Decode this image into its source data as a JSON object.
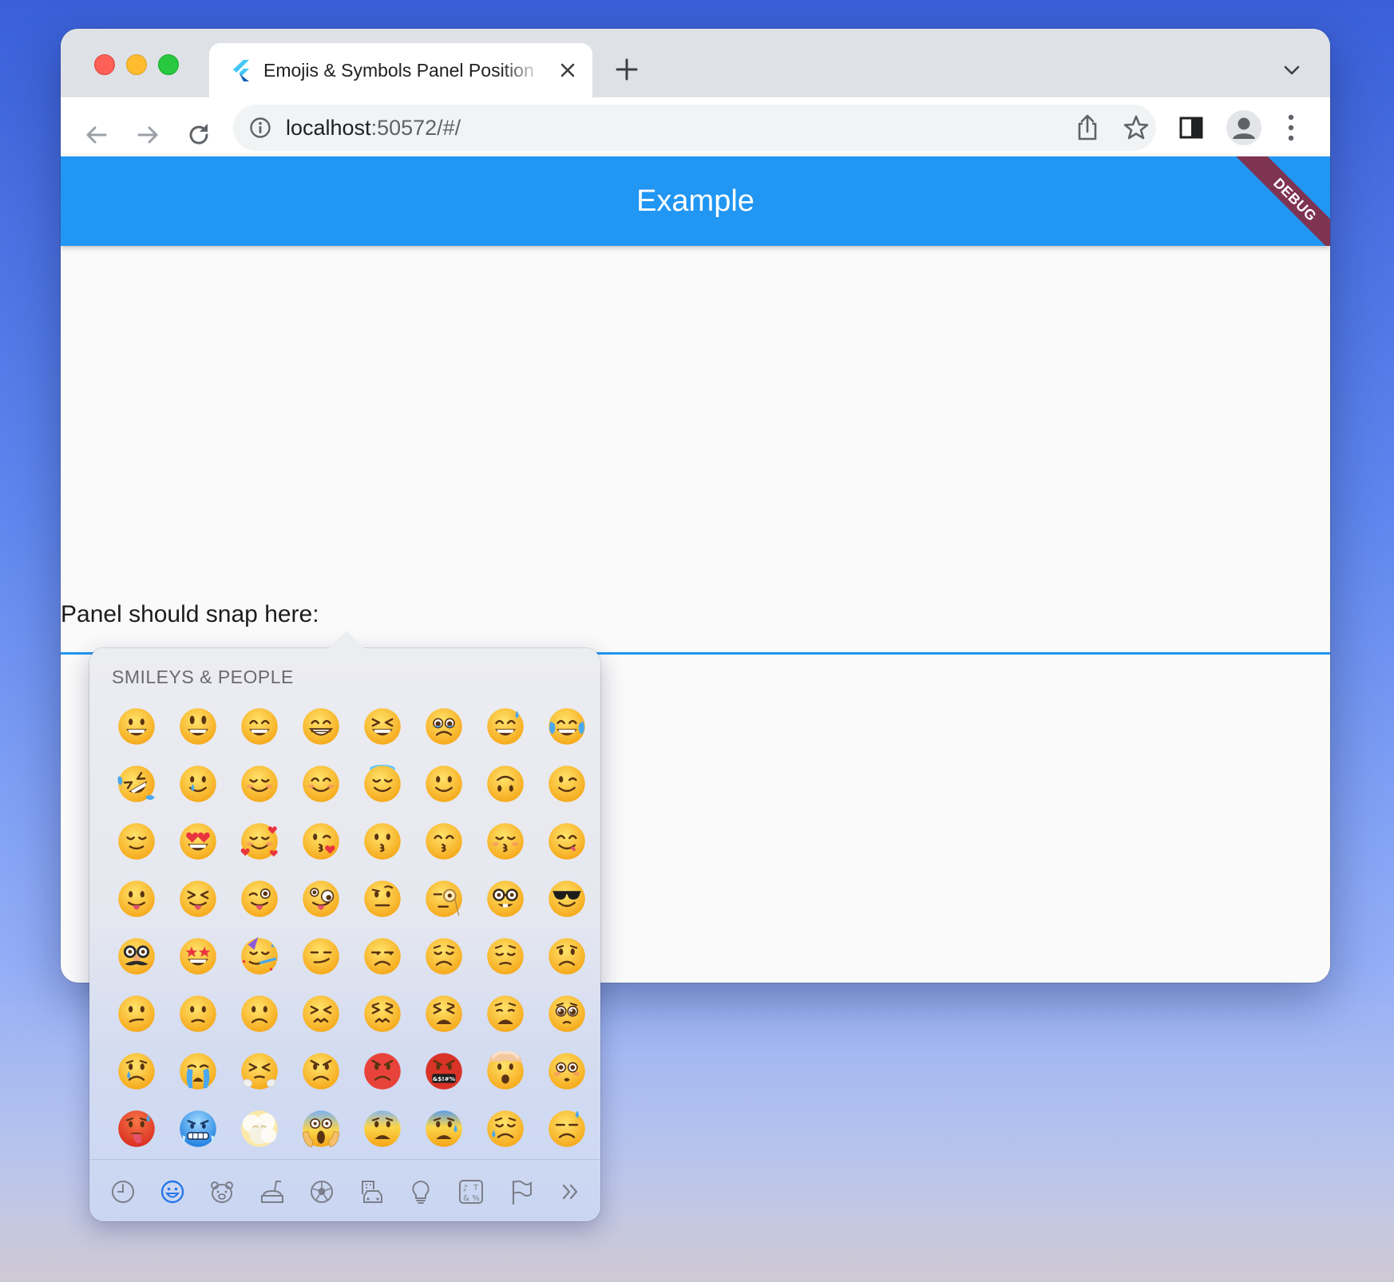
{
  "window": {
    "tab_title": "Emojis & Symbols Panel Position",
    "url_host": "localhost",
    "url_port": ":50572/#/"
  },
  "app": {
    "title": "Example",
    "debug_banner": "DEBUG",
    "snap_label": "Panel should snap here:"
  },
  "panel": {
    "header": "SMILEYS & PEOPLE",
    "emojis": [
      "grinning-face",
      "grinning-face-big-eyes",
      "grinning-face-smiling-eyes",
      "beaming-face",
      "grinning-squinting-face",
      "face-holding-back-tears",
      "grinning-face-sweat",
      "face-tears-of-joy",
      "rolling-on-floor-laughing",
      "smiling-face-with-tear",
      "smiling-face",
      "smiling-face-smiling-eyes",
      "smiling-face-halo",
      "slightly-smiling-face",
      "upside-down-face",
      "winking-face",
      "relieved-face",
      "smiling-face-heart-eyes",
      "smiling-face-hearts",
      "face-blowing-kiss",
      "kissing-face",
      "kissing-face-smiling-eyes",
      "kissing-face-closed-eyes",
      "face-savoring-food",
      "face-with-tongue",
      "squinting-face-tongue",
      "winking-face-tongue",
      "zany-face",
      "face-raised-eyebrow",
      "face-with-monocle",
      "nerd-face",
      "smiling-face-sunglasses",
      "disguised-face",
      "star-struck",
      "partying-face",
      "smirking-face",
      "unamused-face",
      "disappointed-face",
      "pensive-face",
      "worried-face",
      "confused-face",
      "slightly-frowning-face",
      "frowning-face",
      "confounded-face",
      "persevering-face",
      "tired-face",
      "weary-face",
      "pleading-face",
      "crying-face",
      "loudly-crying-face",
      "face-steam-from-nose",
      "angry-face",
      "pouting-face",
      "face-symbols-on-mouth",
      "exploding-head",
      "flushed-face",
      "hot-face",
      "cold-face",
      "face-in-clouds",
      "face-screaming-in-fear",
      "fearful-face",
      "anxious-face-sweat",
      "sad-relieved-face",
      "downcast-face-sweat"
    ],
    "categories": [
      {
        "name": "frequently-used",
        "icon": "clock-icon",
        "selected": false
      },
      {
        "name": "smileys-people",
        "icon": "smiley-icon",
        "selected": true
      },
      {
        "name": "animals-nature",
        "icon": "bear-icon",
        "selected": false
      },
      {
        "name": "food-drink",
        "icon": "food-icon",
        "selected": false
      },
      {
        "name": "activity",
        "icon": "soccer-ball-icon",
        "selected": false
      },
      {
        "name": "travel-places",
        "icon": "buildings-car-icon",
        "selected": false
      },
      {
        "name": "objects",
        "icon": "lightbulb-icon",
        "selected": false
      },
      {
        "name": "symbols",
        "icon": "symbols-icon",
        "selected": false
      },
      {
        "name": "flags",
        "icon": "flag-icon",
        "selected": false
      },
      {
        "name": "more",
        "icon": "chevrons-right-icon",
        "selected": false
      }
    ]
  },
  "colors": {
    "appbar": "#2196f3",
    "debug": "#7e3350",
    "emoji_yellow": "#fbbf24",
    "selected_category": "#2677e8"
  }
}
